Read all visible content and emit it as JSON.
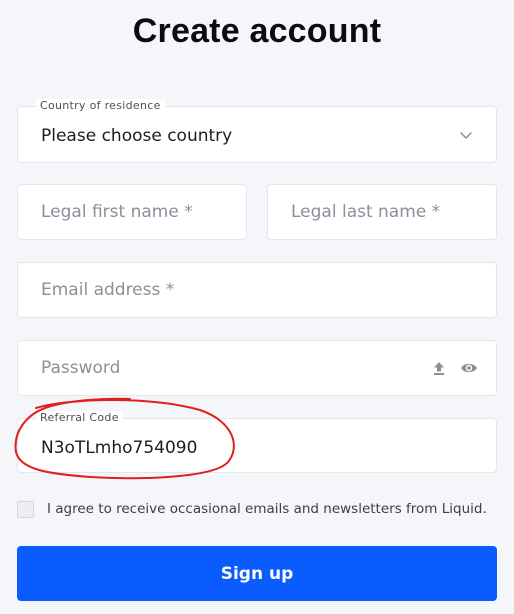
{
  "page": {
    "title": "Create account"
  },
  "form": {
    "country": {
      "label": "Country of residence",
      "value": "Please choose country"
    },
    "first_name": {
      "placeholder": "Legal first name *"
    },
    "last_name": {
      "placeholder": "Legal last name *"
    },
    "email": {
      "placeholder": "Email address *"
    },
    "password": {
      "placeholder": "Password"
    },
    "referral": {
      "label": "Referral Code",
      "value": "N3oTLmho754090"
    },
    "agree": {
      "text": "I agree to receive occasional emails and newsletters from Liquid.",
      "checked": false
    },
    "submit_label": "Sign up"
  },
  "icons": {
    "country_chevron": "chevron-down-icon",
    "password_upload": "upload-icon",
    "password_visibility": "eye-icon"
  },
  "colors": {
    "primary": "#0a5cff",
    "annotation": "#e0201c",
    "background": "#f5f6f9"
  }
}
